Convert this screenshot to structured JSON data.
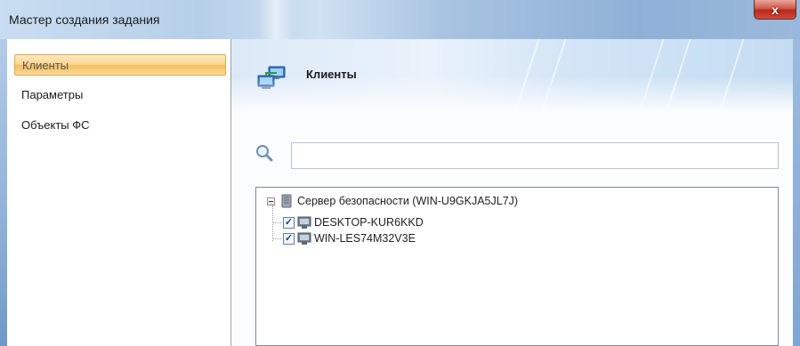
{
  "window": {
    "title": "Мастер создания задания",
    "close_label": "x"
  },
  "nav": {
    "items": [
      {
        "label": "Клиенты",
        "active": true
      },
      {
        "label": "Параметры",
        "active": false
      },
      {
        "label": "Объекты ФС",
        "active": false
      }
    ]
  },
  "content": {
    "header_title": "Клиенты",
    "header_icon": "network-computers-icon",
    "search": {
      "icon": "search-icon",
      "value": "",
      "placeholder": ""
    },
    "tree": {
      "root": {
        "label": "Сервер безопасности (WIN-U9GKJA5JL7J)",
        "icon": "server-icon",
        "expanded": true,
        "children": [
          {
            "label": "DESKTOP-KUR6KKD",
            "checked": true,
            "icon": "computer-icon"
          },
          {
            "label": "WIN-LES74M32V3E",
            "checked": true,
            "icon": "computer-icon"
          }
        ]
      }
    }
  },
  "colors": {
    "nav_active_bg": "#fbd48b",
    "header_bg": "#d3e5f6",
    "close_button": "#c0392b"
  }
}
